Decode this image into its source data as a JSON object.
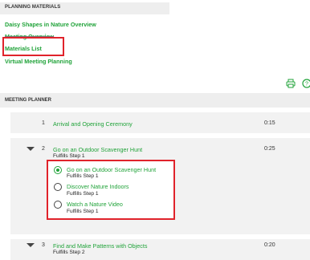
{
  "planning": {
    "title": "PLANNING MATERIALS",
    "links": [
      "Daisy Shapes in Nature Overview",
      "Meeting Overview",
      "Materials List",
      "Virtual Meeting Planning"
    ]
  },
  "planner": {
    "title": "MEETING PLANNER",
    "items": [
      {
        "num": "1",
        "title": "Arrival and Opening Ceremony",
        "duration": "0:15"
      },
      {
        "num": "2",
        "title": "Go on an Outdoor Scavenger Hunt",
        "sub": "Fulfills Step 1",
        "duration": "0:25",
        "options": [
          {
            "label": "Go on an Outdoor Scavenger Hunt",
            "sub": "Fulfills Step 1",
            "selected": true
          },
          {
            "label": "Discover Nature Indoors",
            "sub": "Fulfills Step 1",
            "selected": false
          },
          {
            "label": "Watch a Nature Video",
            "sub": "Fulfills Step 1",
            "selected": false
          }
        ]
      },
      {
        "num": "3",
        "title": "Find and Make Patterns with Objects",
        "sub": "Fulfills Step 2",
        "duration": "0:20"
      }
    ]
  },
  "colors": {
    "accent": "#21a33a",
    "highlight": "#e0232b"
  },
  "icons": [
    "print-icon",
    "help-icon"
  ]
}
